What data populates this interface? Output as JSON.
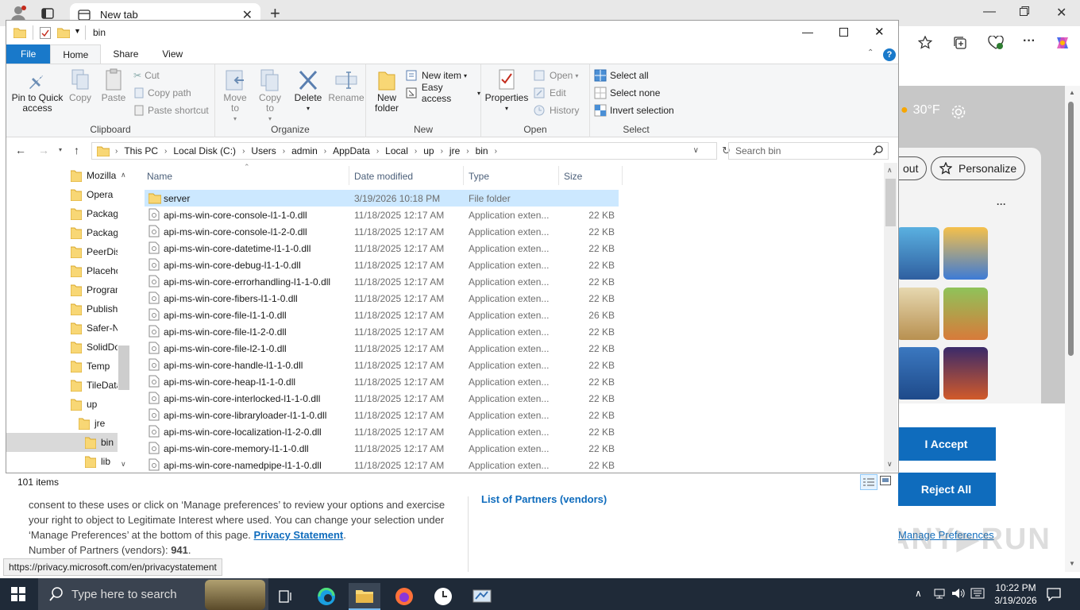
{
  "browser": {
    "tab_title": "New tab",
    "weather_temp": "30°F",
    "personalize_label": "Personalize",
    "partial_button_label": "out",
    "more_dots": "···"
  },
  "consent": {
    "text_line1": "consent to these uses or click on ‘Manage preferences’ to review your options and exercise",
    "text_line2": "your right to object to Legitimate Interest where used.  You can change your selection under",
    "text_line3_prefix": "‘Manage Preferences’ at the bottom of this page.",
    "privacy_link": "Privacy Statement",
    "period": ".",
    "partners_prefix": "Number of Partners (vendors): ",
    "partners_count": "941",
    "partners_link": "List of Partners (vendors)",
    "accept_label": "I Accept",
    "reject_label": "Reject All",
    "manage_label": "Manage Preferences",
    "status_url": "https://privacy.microsoft.com/en/privacystatement"
  },
  "explorer": {
    "window_title": "bin",
    "ribbon_tabs": [
      "File",
      "Home",
      "Share",
      "View"
    ],
    "ribbon": {
      "clipboard": {
        "label": "Clipboard",
        "pin": "Pin to Quick access",
        "copy": "Copy",
        "paste": "Paste",
        "cut": "Cut",
        "copy_path": "Copy path",
        "paste_shortcut": "Paste shortcut"
      },
      "organize": {
        "label": "Organize",
        "move_to": "Move to",
        "copy_to": "Copy to",
        "delete": "Delete",
        "rename": "Rename"
      },
      "new": {
        "label": "New",
        "new_folder": "New folder",
        "new_item": "New item",
        "easy_access": "Easy access"
      },
      "open": {
        "label": "Open",
        "properties": "Properties",
        "open": "Open",
        "edit": "Edit",
        "history": "History"
      },
      "select": {
        "label": "Select",
        "select_all": "Select all",
        "select_none": "Select none",
        "invert": "Invert selection"
      }
    },
    "address_parts": [
      "This PC",
      "Local Disk (C:)",
      "Users",
      "admin",
      "AppData",
      "Local",
      "up",
      "jre",
      "bin"
    ],
    "search_placeholder": "Search bin",
    "nav_items": [
      "Mozilla",
      "Opera",
      "Packag",
      "Packag",
      "PeerDis",
      "Placeho",
      "Program",
      "Publish",
      "Safer-N",
      "SolidDo",
      "Temp",
      "TileData",
      "up",
      "jre",
      "bin",
      "lib"
    ],
    "columns": {
      "name": "Name",
      "date": "Date modified",
      "type": "Type",
      "size": "Size"
    },
    "files": [
      {
        "name": "server",
        "date": "3/19/2026 10:18 PM",
        "type": "File folder",
        "size": "",
        "kind": "folder"
      },
      {
        "name": "api-ms-win-core-console-l1-1-0.dll",
        "date": "11/18/2025 12:17 AM",
        "type": "Application exten...",
        "size": "22 KB",
        "kind": "dll"
      },
      {
        "name": "api-ms-win-core-console-l1-2-0.dll",
        "date": "11/18/2025 12:17 AM",
        "type": "Application exten...",
        "size": "22 KB",
        "kind": "dll"
      },
      {
        "name": "api-ms-win-core-datetime-l1-1-0.dll",
        "date": "11/18/2025 12:17 AM",
        "type": "Application exten...",
        "size": "22 KB",
        "kind": "dll"
      },
      {
        "name": "api-ms-win-core-debug-l1-1-0.dll",
        "date": "11/18/2025 12:17 AM",
        "type": "Application exten...",
        "size": "22 KB",
        "kind": "dll"
      },
      {
        "name": "api-ms-win-core-errorhandling-l1-1-0.dll",
        "date": "11/18/2025 12:17 AM",
        "type": "Application exten...",
        "size": "22 KB",
        "kind": "dll"
      },
      {
        "name": "api-ms-win-core-fibers-l1-1-0.dll",
        "date": "11/18/2025 12:17 AM",
        "type": "Application exten...",
        "size": "22 KB",
        "kind": "dll"
      },
      {
        "name": "api-ms-win-core-file-l1-1-0.dll",
        "date": "11/18/2025 12:17 AM",
        "type": "Application exten...",
        "size": "26 KB",
        "kind": "dll"
      },
      {
        "name": "api-ms-win-core-file-l1-2-0.dll",
        "date": "11/18/2025 12:17 AM",
        "type": "Application exten...",
        "size": "22 KB",
        "kind": "dll"
      },
      {
        "name": "api-ms-win-core-file-l2-1-0.dll",
        "date": "11/18/2025 12:17 AM",
        "type": "Application exten...",
        "size": "22 KB",
        "kind": "dll"
      },
      {
        "name": "api-ms-win-core-handle-l1-1-0.dll",
        "date": "11/18/2025 12:17 AM",
        "type": "Application exten...",
        "size": "22 KB",
        "kind": "dll"
      },
      {
        "name": "api-ms-win-core-heap-l1-1-0.dll",
        "date": "11/18/2025 12:17 AM",
        "type": "Application exten...",
        "size": "22 KB",
        "kind": "dll"
      },
      {
        "name": "api-ms-win-core-interlocked-l1-1-0.dll",
        "date": "11/18/2025 12:17 AM",
        "type": "Application exten...",
        "size": "22 KB",
        "kind": "dll"
      },
      {
        "name": "api-ms-win-core-libraryloader-l1-1-0.dll",
        "date": "11/18/2025 12:17 AM",
        "type": "Application exten...",
        "size": "22 KB",
        "kind": "dll"
      },
      {
        "name": "api-ms-win-core-localization-l1-2-0.dll",
        "date": "11/18/2025 12:17 AM",
        "type": "Application exten...",
        "size": "22 KB",
        "kind": "dll"
      },
      {
        "name": "api-ms-win-core-memory-l1-1-0.dll",
        "date": "11/18/2025 12:17 AM",
        "type": "Application exten...",
        "size": "22 KB",
        "kind": "dll"
      },
      {
        "name": "api-ms-win-core-namedpipe-l1-1-0.dll",
        "date": "11/18/2025 12:17 AM",
        "type": "Application exten...",
        "size": "22 KB",
        "kind": "dll"
      }
    ],
    "item_count": "101 items"
  },
  "taskbar": {
    "search_placeholder": "Type here to search",
    "time": "10:22 PM",
    "date": "3/19/2026"
  },
  "colors": {
    "accent": "#0f6cbd",
    "file_tab": "#1979ca",
    "selection": "#cce8ff",
    "taskbar": "#1f2a38",
    "folder": "#f8d775"
  }
}
